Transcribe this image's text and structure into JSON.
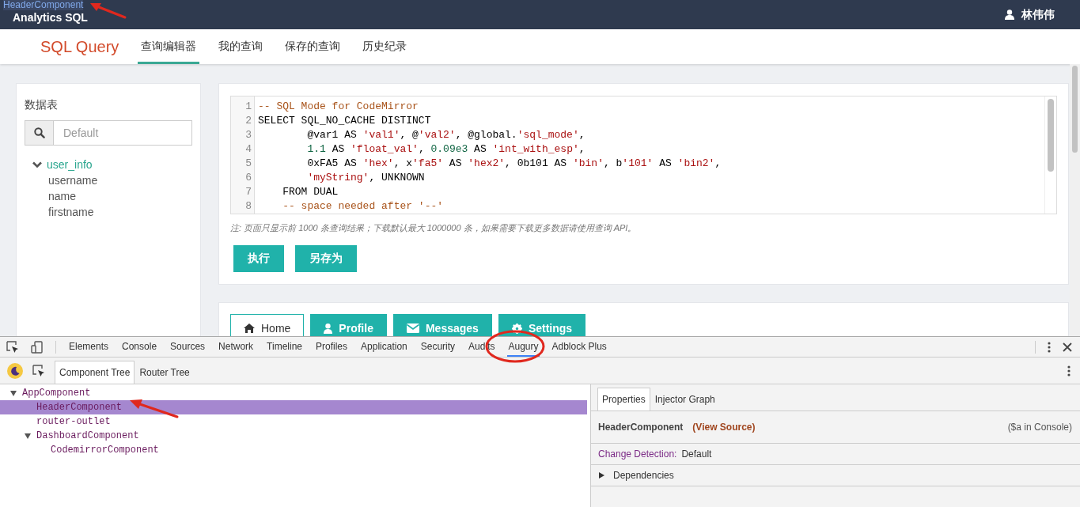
{
  "header": {
    "brand": "Analytics SQL",
    "overlay_label": "HeaderComponent",
    "user_name": "林伟伟"
  },
  "nav": {
    "title": "SQL Query",
    "tabs": [
      {
        "label": "查询编辑器",
        "selected": true
      },
      {
        "label": "我的查询",
        "selected": false
      },
      {
        "label": "保存的查询",
        "selected": false
      },
      {
        "label": "历史纪录",
        "selected": false
      }
    ]
  },
  "sidebar": {
    "title": "数据表",
    "search_placeholder": "Default",
    "tree": [
      {
        "label": "user_info",
        "expanded": true,
        "children": [
          {
            "label": "username"
          },
          {
            "label": "name"
          },
          {
            "label": "firstname"
          }
        ]
      }
    ]
  },
  "editor": {
    "lines": [
      {
        "number": "1",
        "tokens": [
          {
            "text": "-- SQL Mode for CodeMirror",
            "kind": "comment"
          }
        ]
      },
      {
        "number": "2",
        "tokens": [
          {
            "text": "SELECT SQL_NO_CACHE DISTINCT",
            "kind": "plain"
          }
        ]
      },
      {
        "number": "3",
        "tokens": [
          {
            "text": "        @var1 AS ",
            "kind": "plain"
          },
          {
            "text": "'val1'",
            "kind": "string"
          },
          {
            "text": ", @",
            "kind": "plain"
          },
          {
            "text": "'val2'",
            "kind": "string"
          },
          {
            "text": ", @global.",
            "kind": "plain"
          },
          {
            "text": "'sql_mode'",
            "kind": "string"
          },
          {
            "text": ",",
            "kind": "plain"
          }
        ]
      },
      {
        "number": "4",
        "tokens": [
          {
            "text": "        1.1",
            "kind": "number"
          },
          {
            "text": " AS ",
            "kind": "plain"
          },
          {
            "text": "'float_val'",
            "kind": "string"
          },
          {
            "text": ", ",
            "kind": "plain"
          },
          {
            "text": "0.09e3",
            "kind": "number"
          },
          {
            "text": " AS ",
            "kind": "plain"
          },
          {
            "text": "'int_with_esp'",
            "kind": "string"
          },
          {
            "text": ",",
            "kind": "plain"
          }
        ]
      },
      {
        "number": "5",
        "tokens": [
          {
            "text": "        0xFA5 AS ",
            "kind": "plain"
          },
          {
            "text": "'hex'",
            "kind": "string"
          },
          {
            "text": ", x",
            "kind": "plain"
          },
          {
            "text": "'fa5'",
            "kind": "string"
          },
          {
            "text": " AS ",
            "kind": "plain"
          },
          {
            "text": "'hex2'",
            "kind": "string"
          },
          {
            "text": ", 0b101 AS ",
            "kind": "plain"
          },
          {
            "text": "'bin'",
            "kind": "string"
          },
          {
            "text": ", b",
            "kind": "plain"
          },
          {
            "text": "'101'",
            "kind": "string"
          },
          {
            "text": " AS ",
            "kind": "plain"
          },
          {
            "text": "'bin2'",
            "kind": "string"
          },
          {
            "text": ",",
            "kind": "plain"
          }
        ]
      },
      {
        "number": "6",
        "tokens": [
          {
            "text": "        'myString'",
            "kind": "string"
          },
          {
            "text": ", UNKNOWN",
            "kind": "plain"
          }
        ]
      },
      {
        "number": "7",
        "tokens": [
          {
            "text": "    FROM DUAL",
            "kind": "plain"
          }
        ]
      },
      {
        "number": "8",
        "tokens": [
          {
            "text": "    -- space needed after '--'",
            "kind": "comment"
          }
        ]
      }
    ],
    "note": "注: 页面只显示前 1000 条查询结果；下载默认最大 1000000 条，如果需要下载更多数据请使用查询 API。",
    "buttons": [
      "执行",
      "另存为"
    ]
  },
  "panel_tabs": [
    {
      "label": "Home",
      "selected": true
    },
    {
      "label": "Profile",
      "selected": false
    },
    {
      "label": "Messages",
      "selected": false
    },
    {
      "label": "Settings",
      "selected": false
    }
  ],
  "devtools": {
    "tabs": [
      {
        "label": "Elements",
        "selected": false
      },
      {
        "label": "Console",
        "selected": false
      },
      {
        "label": "Sources",
        "selected": false
      },
      {
        "label": "Network",
        "selected": false
      },
      {
        "label": "Timeline",
        "selected": false
      },
      {
        "label": "Profiles",
        "selected": false
      },
      {
        "label": "Application",
        "selected": false
      },
      {
        "label": "Security",
        "selected": false
      },
      {
        "label": "Audits",
        "selected": false
      },
      {
        "label": "Augury",
        "selected": true
      },
      {
        "label": "Adblock Plus",
        "selected": false
      }
    ],
    "subtabs": [
      {
        "label": "Component Tree",
        "selected": true
      },
      {
        "label": "Router Tree",
        "selected": false
      }
    ],
    "tree": [
      {
        "label": "AppComponent",
        "expanded": true,
        "selected": false,
        "children": [
          {
            "label": "HeaderComponent",
            "selected": true
          },
          {
            "label": "router-outlet",
            "selected": false
          },
          {
            "label": "DashboardComponent",
            "expanded": true,
            "selected": false,
            "children": [
              {
                "label": "CodemirrorComponent",
                "selected": false
              }
            ]
          }
        ]
      }
    ],
    "detail_tabs": [
      {
        "label": "Properties",
        "selected": true
      },
      {
        "label": "Injector Graph",
        "selected": false
      }
    ],
    "component_name": "HeaderComponent",
    "view_source": "(View Source)",
    "console_hint": "($a in Console)",
    "change_detection_label": "Change Detection:",
    "change_detection_value": "Default",
    "dependencies": {
      "label": "Dependencies",
      "expanded": false
    }
  }
}
